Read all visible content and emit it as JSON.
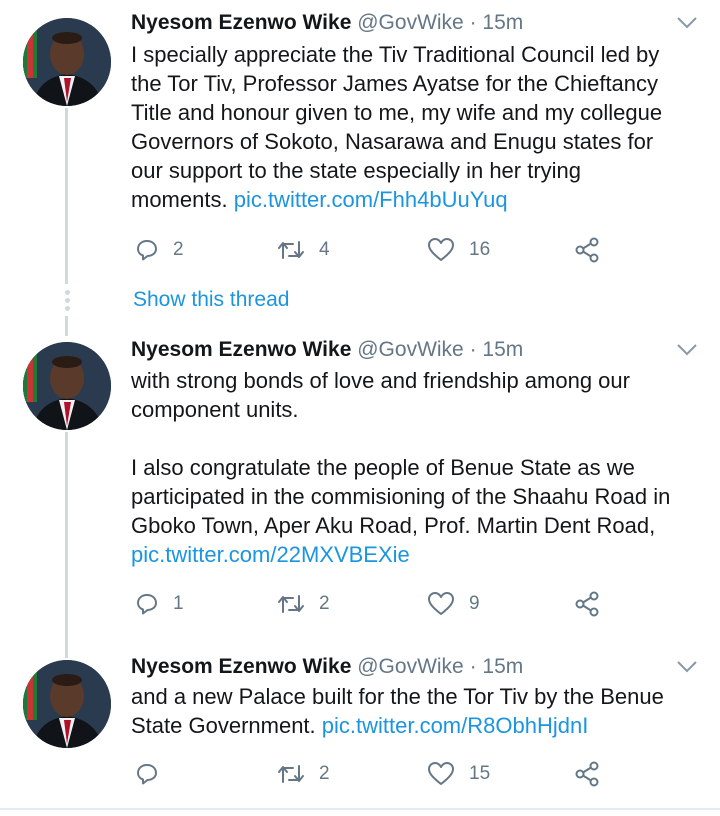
{
  "accent_color": "#1b95e0",
  "muted_color": "#657786",
  "tweets": [
    {
      "name": "Nyesom Ezenwo Wike",
      "handle": "@GovWike",
      "separator": "·",
      "time": "15m",
      "text_lines": [
        "I specially appreciate the Tiv Traditional Council led by",
        "the Tor Tiv, Professor James Ayatse for the Chieftancy",
        "Title and honour given to me, my wife and my collegue",
        "Governors of Sokoto, Nasarawa and Enugu states for",
        "our support to the state especially in her trying",
        "moments. "
      ],
      "link": "pic.twitter.com/Fhh4bUuYuq",
      "replies": "2",
      "retweets": "4",
      "likes": "16"
    },
    {
      "name": "Nyesom Ezenwo Wike",
      "handle": "@GovWike",
      "separator": "·",
      "time": "15m",
      "text_lines": [
        "with strong bonds of love and friendship among our",
        "component units.",
        "",
        "I also congratulate the people of Benue State as we",
        "participated in the commisioning of the Shaahu Road in",
        "Gboko Town, Aper Aku Road, Prof. Martin Dent Road,"
      ],
      "link": "pic.twitter.com/22MXVBEXie",
      "replies": "1",
      "retweets": "2",
      "likes": "9"
    },
    {
      "name": "Nyesom Ezenwo Wike",
      "handle": "@GovWike",
      "separator": "·",
      "time": "15m",
      "text_lines": [
        "and a new Palace built for the the Tor Tiv by the Benue",
        "State Government. "
      ],
      "link": "pic.twitter.com/R8ObhHjdnI",
      "replies": "",
      "retweets": "2",
      "likes": "15"
    }
  ],
  "show_thread_label": "Show this thread"
}
